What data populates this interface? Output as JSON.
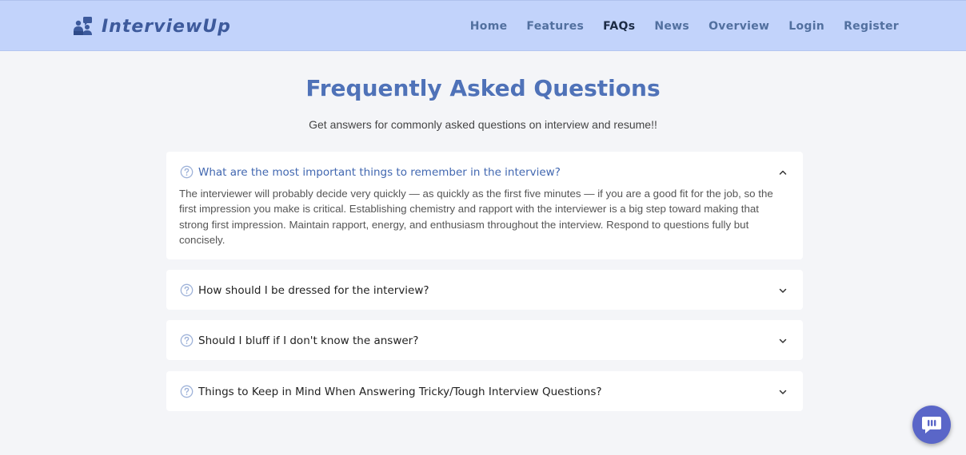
{
  "brand": {
    "name": "InterviewUp",
    "logo_icon": "people-interview-icon"
  },
  "nav": {
    "items": [
      {
        "label": "Home",
        "active": false
      },
      {
        "label": "Features",
        "active": false
      },
      {
        "label": "FAQs",
        "active": true
      },
      {
        "label": "News",
        "active": false
      },
      {
        "label": "Overview",
        "active": false
      },
      {
        "label": "Login",
        "active": false
      },
      {
        "label": "Register",
        "active": false
      }
    ]
  },
  "page": {
    "title": "Frequently Asked Questions",
    "subtitle": "Get answers for commonly asked questions on interview and resume!!"
  },
  "faqs": [
    {
      "question": "What are the most important things to remember in the interview?",
      "answer": "The interviewer will probably decide very quickly — as quickly as the first five minutes — if you are a good fit for the job, so the first impression you make is critical. Establishing chemistry and rapport with the interviewer is a big step toward making that strong first impression. Maintain rapport, energy, and enthusiasm throughout the interview. Respond to questions fully but concisely.",
      "expanded": true
    },
    {
      "question": "How should I be dressed for the interview?",
      "expanded": false
    },
    {
      "question": "Should I bluff if I don't know the answer?",
      "expanded": false
    },
    {
      "question": "Things to Keep in Mind When Answering Tricky/Tough Interview Questions?",
      "expanded": false
    }
  ],
  "chat_widget": {
    "icon": "chat-bubble-icon"
  },
  "colors": {
    "navbar_bg": "#c2d3fb",
    "brand": "#3d5a9c",
    "title": "#4f72b8",
    "active_question": "#4167b0",
    "chat_button": "#5a66c8"
  }
}
